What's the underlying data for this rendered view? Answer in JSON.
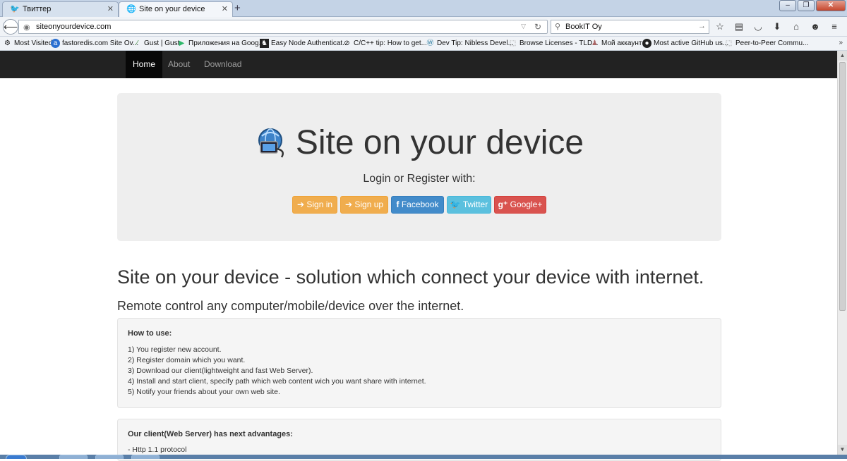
{
  "browser": {
    "tabs": [
      {
        "title": "Твиттер",
        "icon": "twitter-bird-icon",
        "active": false
      },
      {
        "title": "Site on your device",
        "icon": "globe-icon",
        "active": true
      }
    ],
    "new_tab_symbol": "+",
    "url": "siteonyourdevice.com",
    "search_text": "BookIT Oy",
    "bookmarks": [
      "Most Visited",
      "fastoredis.com Site Ov...",
      "Gust | Gust",
      "Приложения на Goog...",
      "Easy Node Authenticat...",
      "C/C++ tip: How to get...",
      "Dev Tip: Nibless Devel...",
      "Browse Licenses - TLD...",
      "Мой аккаунт",
      "Most active GitHub us...",
      "Peer-to-Peer Commu..."
    ],
    "bookmarks_overflow": "»"
  },
  "site": {
    "nav": {
      "home": "Home",
      "about": "About",
      "download": "Download"
    },
    "hero": {
      "title": "Site on your device",
      "subtitle": "Login or Register with:",
      "buttons": {
        "signin": "Sign in",
        "signup": "Sign up",
        "facebook": "Facebook",
        "twitter": "Twitter",
        "google": "Google+"
      }
    },
    "headline": "Site on your device - solution which connect your device with internet.",
    "subheadline": "Remote control any computer/mobile/device over the internet.",
    "howto": {
      "title": "How to use:",
      "steps": [
        "1) You register new account.",
        "2) Register domain which you want.",
        "3) Download our client(lightweight and fast Web Server).",
        "4) Install and start client, specify path which web content wich you want share with internet.",
        "5) Notify your friends about your own web site."
      ]
    },
    "advantages": {
      "title": "Our client(Web Server) has next advantages:",
      "items": [
        "- Http 1.1 protocol"
      ]
    }
  },
  "colors": {
    "navbar": "#222222",
    "warning": "#f0ad4e",
    "primary": "#428bca",
    "info": "#5bc0de",
    "danger": "#d9534f"
  }
}
